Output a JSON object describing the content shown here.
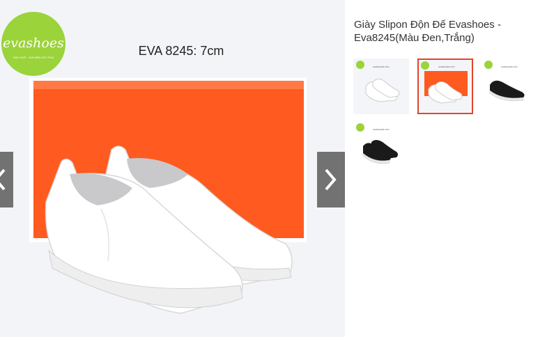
{
  "product": {
    "title": "Giày Slipon Độn Đế Evashoes - Eva8245(Màu Đen,Trắng)"
  },
  "main_image": {
    "brand_logo_text": "evashoes",
    "brand_tagline": "GIÀY ĐẸP - GIÁ MỀM VỚI THÚI",
    "caption": "EVA 8245: 7cm"
  },
  "thumbnails": [
    {
      "color": "white",
      "caption": "EVASHOES 7KN",
      "active": false
    },
    {
      "color": "white",
      "caption": "EVASHOES 7KN",
      "active": true
    },
    {
      "color": "black",
      "caption": "EVASHOES 7KN",
      "active": false
    },
    {
      "color": "black",
      "caption": "EVASHOES 7KN",
      "active": false
    }
  ],
  "colors": {
    "accent": "#e0452b",
    "logo_green": "#9bd33a",
    "box_orange": "#ff5a1f",
    "nav_bg": "#5a5a5a"
  }
}
